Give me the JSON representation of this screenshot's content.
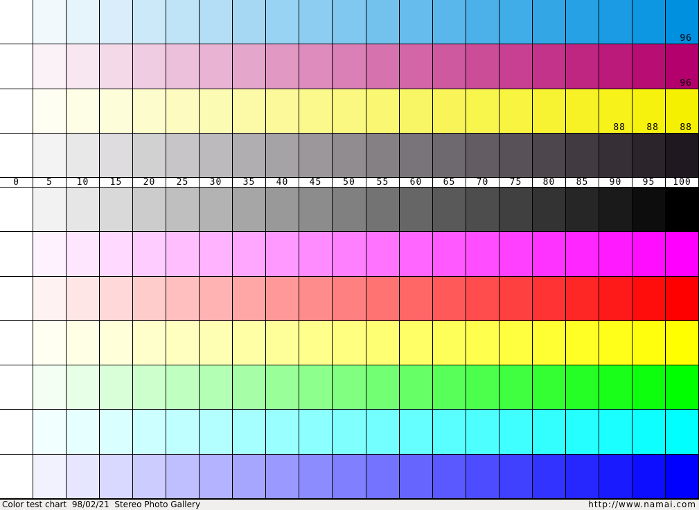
{
  "columns": [
    "0",
    "5",
    "10",
    "15",
    "20",
    "25",
    "30",
    "35",
    "40",
    "45",
    "50",
    "55",
    "60",
    "65",
    "70",
    "75",
    "80",
    "85",
    "90",
    "95",
    "100"
  ],
  "top_rows": [
    {
      "name": "cyan-ink",
      "end": "#0090e0",
      "badges": [
        {
          "col": 20,
          "text": "96"
        }
      ]
    },
    {
      "name": "magenta-ink",
      "end": "#b4006c",
      "badges": [
        {
          "col": 20,
          "text": "96"
        }
      ]
    },
    {
      "name": "yellow-ink",
      "end": "#f5f000",
      "badges": [
        {
          "col": 18,
          "text": "88"
        },
        {
          "col": 19,
          "text": "88"
        },
        {
          "col": 20,
          "text": "88"
        }
      ]
    },
    {
      "name": "black-ink",
      "end": "#201820",
      "badges": []
    }
  ],
  "bottom_rows": [
    {
      "name": "gray",
      "end": "#000000"
    },
    {
      "name": "magenta",
      "end": "#ff00ff"
    },
    {
      "name": "red",
      "end": "#ff0000"
    },
    {
      "name": "yellow",
      "end": "#ffff00"
    },
    {
      "name": "green",
      "end": "#00ff00"
    },
    {
      "name": "cyan",
      "end": "#00ffff"
    },
    {
      "name": "blue",
      "end": "#0000ff"
    }
  ],
  "footer": {
    "left_text": "Color test chart  98/02/21  Stereo Photo Gallery",
    "right_text": "http://www.namai.com"
  }
}
